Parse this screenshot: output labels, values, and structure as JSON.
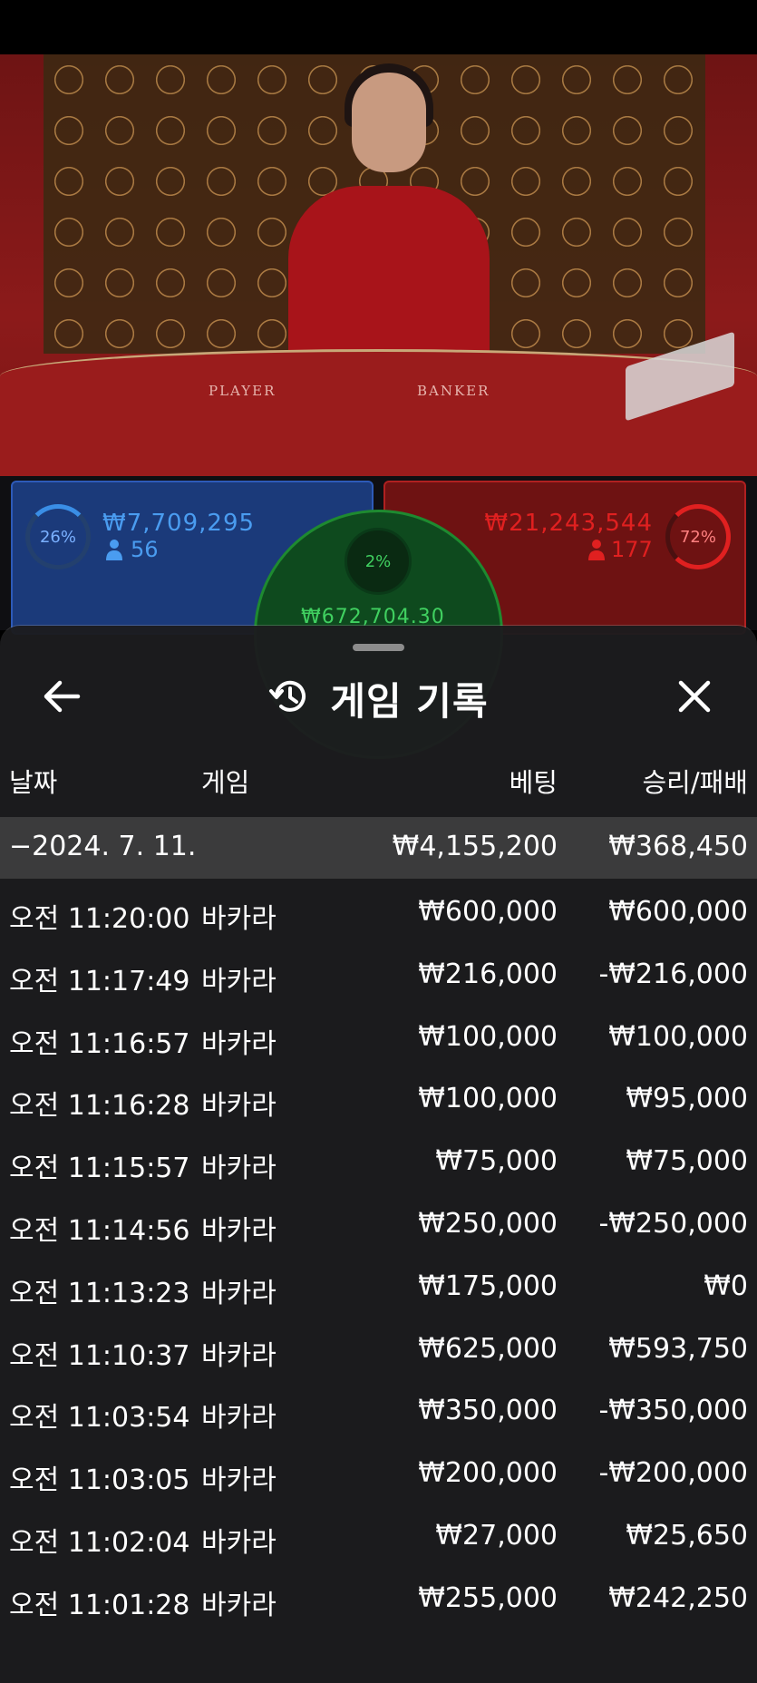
{
  "stream": {
    "table_labels": {
      "player": "PLAYER",
      "banker": "BANKER"
    },
    "player_bet": {
      "percent": "26%",
      "amount": "₩7,709,295",
      "bettors": "56",
      "color": "#3a8ee6"
    },
    "banker_bet": {
      "percent": "72%",
      "amount": "₩21,243,544",
      "bettors": "177",
      "color": "#e02020"
    },
    "tie_bet": {
      "percent": "2%",
      "amount": "₩672,704.30",
      "color": "#40d060"
    }
  },
  "history": {
    "title": "게임 기록",
    "icons": {
      "back": "arrow-left-icon",
      "history": "history-icon",
      "close": "close-icon",
      "user": "user-icon"
    },
    "columns": {
      "date": "날짜",
      "game": "게임",
      "bet": "베팅",
      "result": "승리/패배"
    },
    "day_summary": {
      "date": "−2024. 7. 11.",
      "bet": "₩4,155,200",
      "result": "₩368,450"
    },
    "rows": [
      {
        "time": "오전 11:20:00",
        "game": "바카라",
        "bet": "₩600,000",
        "result": "₩600,000"
      },
      {
        "time": "오전 11:17:49",
        "game": "바카라",
        "bet": "₩216,000",
        "result": "-₩216,000"
      },
      {
        "time": "오전 11:16:57",
        "game": "바카라",
        "bet": "₩100,000",
        "result": "₩100,000"
      },
      {
        "time": "오전 11:16:28",
        "game": "바카라",
        "bet": "₩100,000",
        "result": "₩95,000"
      },
      {
        "time": "오전 11:15:57",
        "game": "바카라",
        "bet": "₩75,000",
        "result": "₩75,000"
      },
      {
        "time": "오전 11:14:56",
        "game": "바카라",
        "bet": "₩250,000",
        "result": "-₩250,000"
      },
      {
        "time": "오전 11:13:23",
        "game": "바카라",
        "bet": "₩175,000",
        "result": "₩0"
      },
      {
        "time": "오전 11:10:37",
        "game": "바카라",
        "bet": "₩625,000",
        "result": "₩593,750"
      },
      {
        "time": "오전 11:03:54",
        "game": "바카라",
        "bet": "₩350,000",
        "result": "-₩350,000"
      },
      {
        "time": "오전 11:03:05",
        "game": "바카라",
        "bet": "₩200,000",
        "result": "-₩200,000"
      },
      {
        "time": "오전 11:02:04",
        "game": "바카라",
        "bet": "₩27,000",
        "result": "₩25,650"
      },
      {
        "time": "오전 11:01:28",
        "game": "바카라",
        "bet": "₩255,000",
        "result": "₩242,250"
      }
    ]
  }
}
